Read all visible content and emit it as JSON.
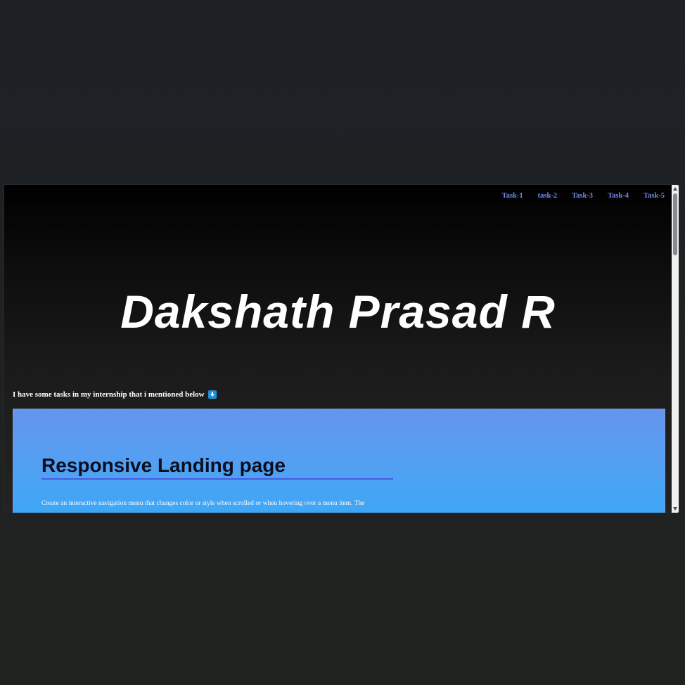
{
  "nav": {
    "items": [
      {
        "label": "Task-1"
      },
      {
        "label": "task-2"
      },
      {
        "label": "Task-3"
      },
      {
        "label": "Task-4"
      },
      {
        "label": "Task-5"
      }
    ]
  },
  "hero": {
    "title": "Dakshath Prasad R"
  },
  "intro": {
    "text": "I have some tasks in my internship that i mentioned below",
    "icon": "down-arrow-icon"
  },
  "task": {
    "title": "Responsive Landing page",
    "description": "Create an interactive navigation menu that changes color or style when scrolled or when hovering over a menu item. The"
  },
  "colors": {
    "nav_link": "#6f8cf0",
    "card_top": "#6595ed",
    "card_bottom": "#3aa8f6",
    "title_underline": "#4a5be0"
  }
}
